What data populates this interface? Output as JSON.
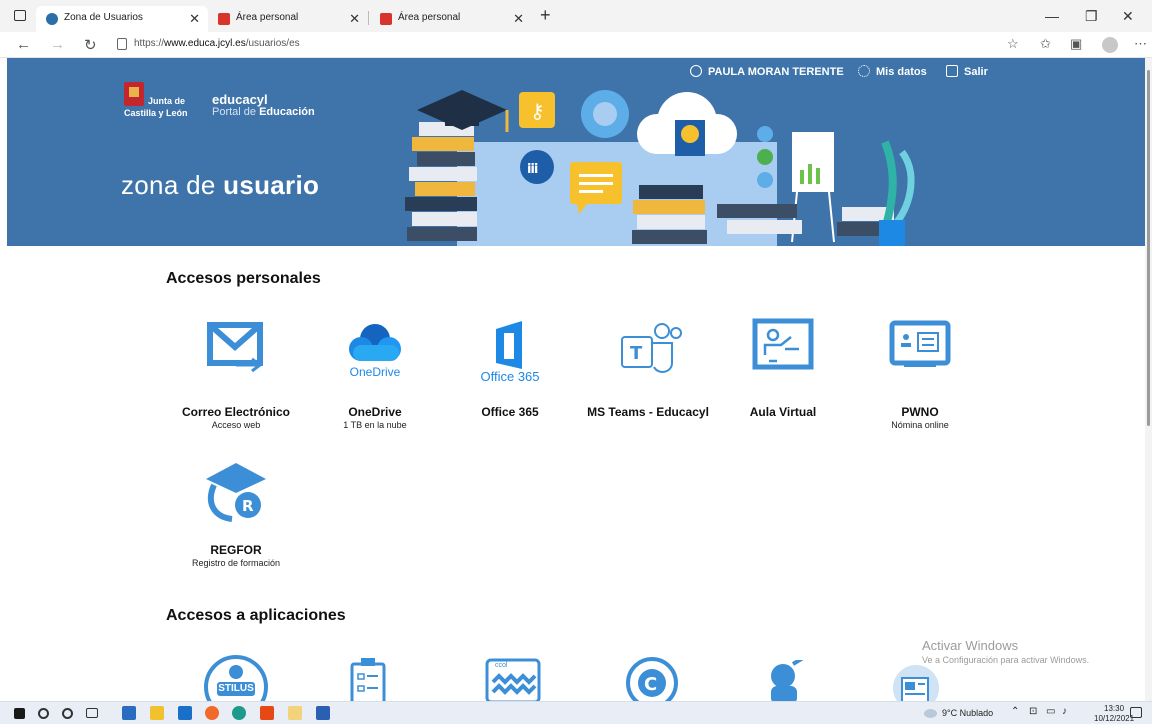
{
  "browser": {
    "tabs": [
      {
        "title": "Zona de Usuarios",
        "active": true
      },
      {
        "title": "Área personal",
        "active": false
      },
      {
        "title": "Área personal",
        "active": false
      }
    ],
    "url_prefix": "https://",
    "url_host": "www.educa.jcyl.es",
    "url_path": "/usuarios/es"
  },
  "header": {
    "jcyl_top": "Junta de",
    "jcyl_bottom": "Castilla y León",
    "brand_name": "educacyl",
    "brand_sub_plain": "Portal de",
    "brand_sub_bold": "Educación",
    "zona_plain": "zona de",
    "zona_bold": "usuario",
    "user_name": "PAULA MORAN TERENTE",
    "mis_datos": "Mis datos",
    "salir": "Salir"
  },
  "sections": {
    "personal_title": "Accesos personales",
    "apps_title": "Accesos a aplicaciones"
  },
  "tiles": [
    {
      "name": "Correo Electrónico",
      "sub": "Acceso web",
      "icon": "mail-icon"
    },
    {
      "name": "OneDrive",
      "sub": "1 TB en la nube",
      "icon": "onedrive-icon",
      "logo_text": "OneDrive"
    },
    {
      "name": "Office 365",
      "sub": "",
      "icon": "office365-icon",
      "logo_text": "Office 365"
    },
    {
      "name": "MS Teams - Educacyl",
      "sub": "",
      "icon": "teams-icon"
    },
    {
      "name": "Aula Virtual",
      "sub": "",
      "icon": "aula-virtual-icon"
    },
    {
      "name": "PWNO",
      "sub": "Nómina online",
      "icon": "pwno-icon"
    },
    {
      "name": "REGFOR",
      "sub": "Registro de formación",
      "icon": "regfor-icon"
    }
  ],
  "apps": [
    {
      "icon": "stilus-icon",
      "logo_text": "STILUS"
    },
    {
      "icon": "clipboard-icon"
    },
    {
      "icon": "certificate-icon",
      "logo_text": "ccol"
    },
    {
      "icon": "c-logo-icon"
    },
    {
      "icon": "character-icon"
    },
    {
      "icon": "document-icon"
    }
  ],
  "watermark": {
    "line1": "Activar Windows",
    "line2": "Ve a Configuración para activar Windows."
  },
  "taskbar": {
    "weather": "9°C  Nublado",
    "time": "13:30",
    "date": "10/12/2021"
  },
  "colors": {
    "banner": "#3e74aa",
    "icon_blue": "#1e88e5",
    "office_orange": "#eb3c00"
  }
}
